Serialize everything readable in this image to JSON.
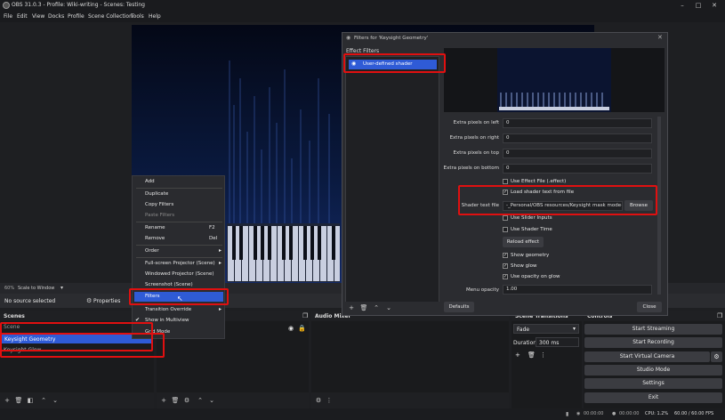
{
  "window": {
    "title": "OBS 31.0.3 - Profile: Wiki-writing - Scenes: Testing",
    "min": "–",
    "max": "□",
    "close": "✕"
  },
  "menu": [
    "File",
    "Edit",
    "View",
    "Docks",
    "Profile",
    "Scene Collection",
    "Tools",
    "Help"
  ],
  "strip": {
    "zoom": "60%",
    "scale": "Scale to Window"
  },
  "sources_bar": {
    "no_source": "No source selected",
    "properties": "Properties"
  },
  "docks": {
    "scenes": "Scenes",
    "audio_mixer": "Audio Mixer",
    "scene_transitions": "Scene Transitions",
    "controls": "Controls"
  },
  "scenes": [
    {
      "name": "Scene"
    },
    {
      "name": "Keysight Geometry"
    },
    {
      "name": "Keysight Glow"
    }
  ],
  "transitions": {
    "type": "Fade",
    "duration_label": "Duration",
    "duration_value": "300 ms"
  },
  "controls": {
    "start_streaming": "Start Streaming",
    "start_recording": "Start Recording",
    "start_virtual_camera": "Start Virtual Camera",
    "studio_mode": "Studio Mode",
    "settings": "Settings",
    "exit": "Exit"
  },
  "status": {
    "rec_time": "00:00:00",
    "stream_time": "00:00:00",
    "cpu": "CPU: 1.2%",
    "fps": "60.00 / 60.00 FPS"
  },
  "context_menu": {
    "add": "Add",
    "duplicate": "Duplicate",
    "copy_filters": "Copy Filters",
    "paste_filters": "Paste Filters",
    "rename": "Rename",
    "rename_key": "F2",
    "remove": "Remove",
    "remove_key": "Del",
    "order": "Order",
    "fullscreen_projector": "Full-screen Projector (Scene)",
    "windowed_projector": "Windowed Projector (Scene)",
    "screenshot": "Screenshot (Scene)",
    "filters": "Filters",
    "transition_override": "Transition Override",
    "show_in_multiview": "Show in Multiview",
    "grid_mode": "Grid Mode"
  },
  "filters_dialog": {
    "title": "Filters for 'Keysight Geometry'",
    "effect_filters": "Effect Filters",
    "filter_name": "User-defined shader",
    "fields": {
      "left_label": "Extra pixels on left",
      "left_value": "0",
      "right_label": "Extra pixels on right",
      "right_value": "0",
      "top_label": "Extra pixels on top",
      "top_value": "0",
      "bottom_label": "Extra pixels on bottom",
      "bottom_value": "0"
    },
    "use_effect_file": "Use Effect File (.effect)",
    "load_shader_text": "Load shader text from file",
    "shader_text_file_label": "Shader text file",
    "shader_text_file_value": "-_Personal/OBS resources/Keysight mask mode+.txt",
    "browse": "Browse",
    "use_slider_inputs": "Use Slider Inputs",
    "use_shader_time": "Use Shader Time",
    "reload_effect": "Reload effect",
    "show_geometry": "Show geometry",
    "show_glow": "Show glow",
    "use_opacity_on_glow": "Use opacity on glow",
    "menu_opacity_label": "Menu opacity",
    "menu_opacity_value": "1.00",
    "defaults": "Defaults",
    "close": "Close"
  },
  "colors": {
    "accent": "#2f5bd6",
    "highlight": "#e01010"
  }
}
